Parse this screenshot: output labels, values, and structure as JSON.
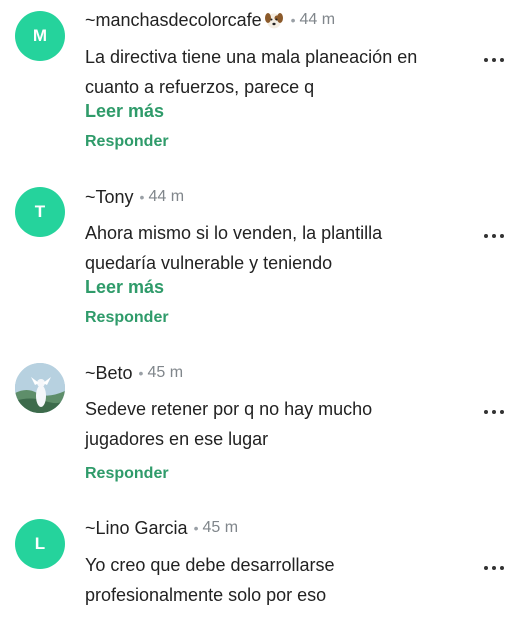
{
  "comments": [
    {
      "avatar": "M",
      "author": "~manchasdecolorcafe",
      "author_emoji": "dog-emoji",
      "separator": "•",
      "time": "44 m",
      "text_line1": "La directiva tiene una mala planeación en",
      "text_line2": "cuanto a refuerzos, parece q",
      "more": "Leer más",
      "reply": "Responder"
    },
    {
      "avatar": "T",
      "author": "~Tony",
      "separator": "•",
      "time": "44 m",
      "text_line1": "Ahora mismo si lo venden, la plantilla",
      "text_line2": "quedaría vulnerable y teniendo",
      "more": "Leer más",
      "reply": "Responder"
    },
    {
      "avatar": "photo",
      "author": "~Beto",
      "separator": "•",
      "time": "45 m",
      "text_line1": "Sedeve retener por q no hay mucho",
      "text_line2": "jugadores en ese lugar",
      "reply": "Responder"
    },
    {
      "avatar": "L",
      "author": "~Lino Garcia",
      "separator": "•",
      "time": "45 m",
      "text_line1": "Yo creo que debe desarrollarse",
      "text_line2": "profesionalmente solo por eso"
    }
  ],
  "colors": {
    "avatar_bg": "#25d39c",
    "link_green": "#2f9b6a",
    "text": "#222222",
    "meta": "#80868b"
  },
  "icons": {
    "more_options": "more-horizontal-icon"
  }
}
